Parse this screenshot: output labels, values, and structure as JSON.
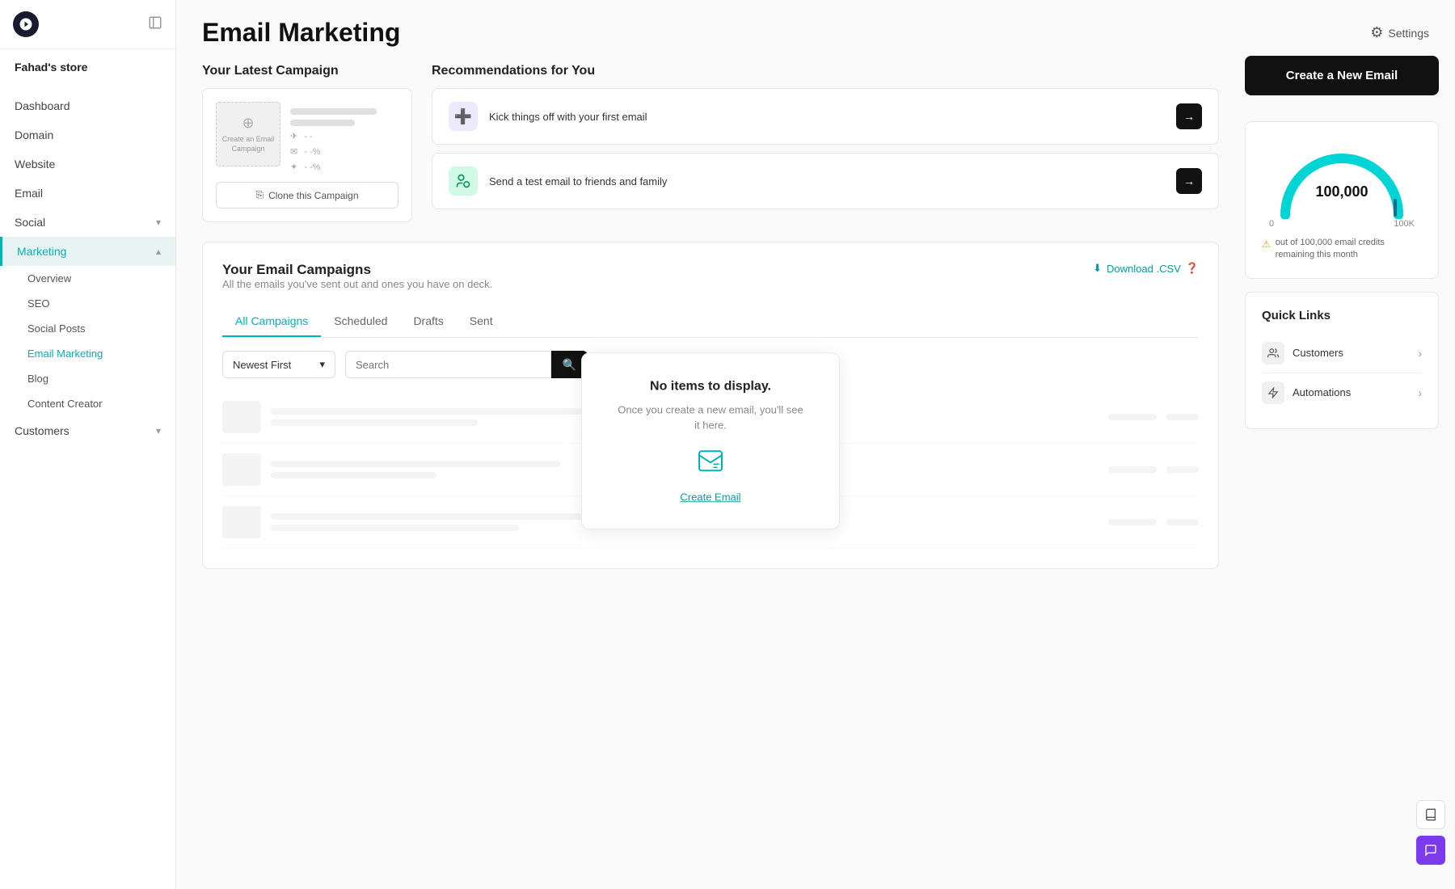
{
  "sidebar": {
    "store_name": "Fahad's store",
    "nav_items": [
      {
        "label": "Dashboard",
        "has_sub": false,
        "active": false
      },
      {
        "label": "Domain",
        "has_sub": false,
        "active": false
      },
      {
        "label": "Website",
        "has_sub": false,
        "active": false
      },
      {
        "label": "Email",
        "has_sub": false,
        "active": false
      },
      {
        "label": "Social",
        "has_sub": true,
        "active": false
      },
      {
        "label": "Marketing",
        "has_sub": true,
        "active": true
      }
    ],
    "marketing_sub": [
      {
        "label": "Overview",
        "active": false
      },
      {
        "label": "SEO",
        "active": false
      },
      {
        "label": "Social Posts",
        "active": false
      },
      {
        "label": "Email Marketing",
        "active": true
      },
      {
        "label": "Blog",
        "active": false
      },
      {
        "label": "Content Creator",
        "active": false
      }
    ],
    "customers": {
      "label": "Customers",
      "has_sub": true
    }
  },
  "header": {
    "title": "Email Marketing",
    "settings_label": "Settings"
  },
  "latest_campaign": {
    "section_title": "Your Latest Campaign",
    "preview_label": "Create an Email Campaign",
    "stats": [
      {
        "icon": "✉",
        "value": "- -"
      },
      {
        "icon": "✉",
        "value": "- -%"
      },
      {
        "icon": "✦",
        "value": "- -%"
      }
    ],
    "clone_btn": "Clone this Campaign"
  },
  "recommendations": {
    "section_title": "Recommendations for You",
    "items": [
      {
        "text": "Kick things off with your first email",
        "icon": "➕"
      },
      {
        "text": "Send a test email to friends and family",
        "icon": "👥"
      }
    ]
  },
  "campaigns": {
    "title": "Your Email Campaigns",
    "subtitle": "All the emails you've sent out and ones you have on deck.",
    "download_csv": "Download .CSV",
    "tabs": [
      "All Campaigns",
      "Scheduled",
      "Drafts",
      "Sent"
    ],
    "active_tab": "All Campaigns",
    "sort_label": "Newest First",
    "search_placeholder": "Search",
    "no_items": {
      "title": "No items to display.",
      "description": "Once you create a new email, you'll see it here.",
      "create_link": "Create Email"
    }
  },
  "right_panel": {
    "create_btn": "Create a New Email",
    "credits": {
      "value": "100,000",
      "min": "0",
      "max": "100K",
      "warning": "out of 100,000 email credits remaining this month"
    },
    "quick_links": {
      "title": "Quick Links",
      "items": [
        {
          "label": "Customers",
          "icon": "👤"
        },
        {
          "label": "Automations",
          "icon": "⚡"
        }
      ]
    }
  }
}
